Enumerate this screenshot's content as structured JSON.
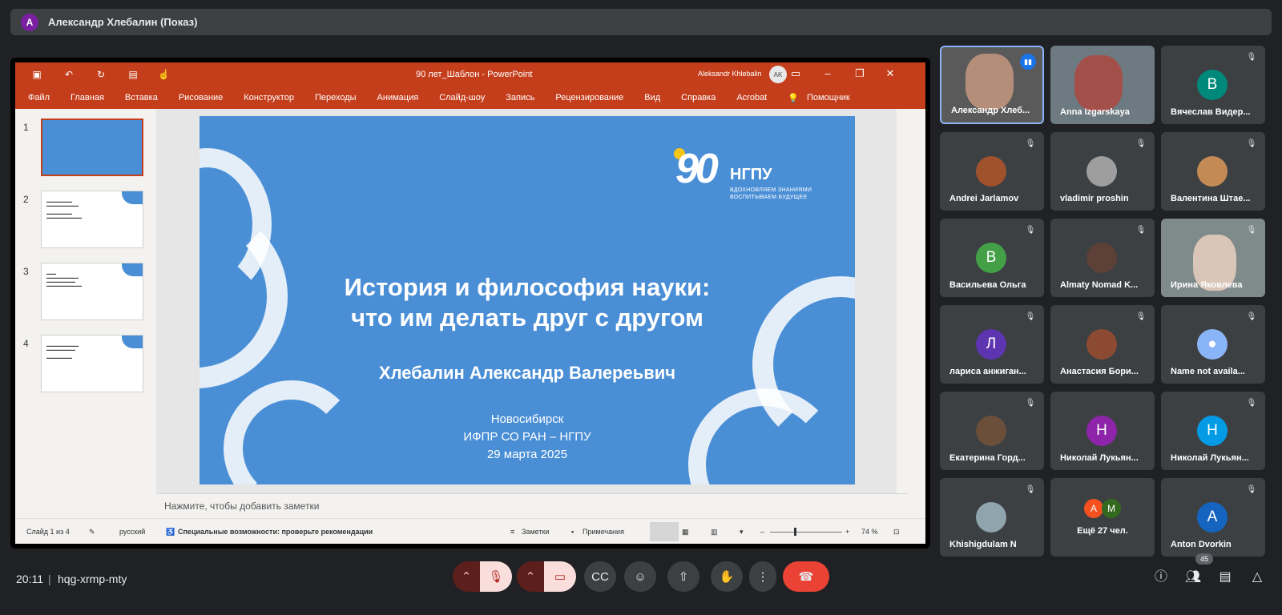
{
  "presenter": {
    "avatar_letter": "А",
    "label": "Александр Хлебалин (Показ)"
  },
  "ppt": {
    "doc_title": "90 лет_Шаблон  -  PowerPoint",
    "account": "Aleksandr Khlebalin",
    "account_initials": "AK",
    "menu": [
      "Файл",
      "Главная",
      "Вставка",
      "Рисование",
      "Конструктор",
      "Переходы",
      "Анимация",
      "Слайд-шоу",
      "Запись",
      "Рецензирование",
      "Вид",
      "Справка",
      "Acrobat"
    ],
    "helper": "Помощник",
    "thumb_numbers": [
      "1",
      "2",
      "3",
      "4"
    ],
    "slide": {
      "title_line1": "История и философия науки:",
      "title_line2": "что им делать друг с другом",
      "author": "Хлебалин Александр Валереьвич",
      "city": "Новосибирск",
      "org": "ИФПР СО РАН – НГПУ",
      "date": "29 марта 2025",
      "logo_number": "90",
      "logo_name": "НГПУ",
      "logo_tag1": "ВДОХНОВЛЯЕМ ЗНАНИЯМИ",
      "logo_tag2": "ВОСПИТЫВАЕМ БУДУЩЕЕ"
    },
    "notes_placeholder": "Нажмите, чтобы добавить заметки",
    "status": {
      "slide": "Слайд 1 из 4",
      "lang": "русский",
      "accessibility": "Специальные возможности: проверьте рекомендации",
      "notes": "Заметки",
      "comments": "Примечания",
      "zoom": "74 %"
    }
  },
  "participants": [
    {
      "name": "Александр Хлеб...",
      "type": "video",
      "speaking": true
    },
    {
      "name": "Anna Izgarskaya",
      "type": "video"
    },
    {
      "name": "Вячеслав Видер...",
      "letter": "В",
      "color": "#00897b"
    },
    {
      "name": "Andrei Jarlamov",
      "type": "photo"
    },
    {
      "name": "vladimir proshin",
      "type": "photo"
    },
    {
      "name": "Валентина Штае...",
      "type": "photo"
    },
    {
      "name": "Васильева Ольга",
      "letter": "В",
      "color": "#43a047"
    },
    {
      "name": "Almaty Nomad K...",
      "type": "photo"
    },
    {
      "name": "Ирина Яковлева",
      "type": "video"
    },
    {
      "name": "лариса анжиган...",
      "letter": "Л",
      "color": "#5e35b1"
    },
    {
      "name": "Анастасия Бори...",
      "type": "photo"
    },
    {
      "name": "Name not availa...",
      "type": "generic"
    },
    {
      "name": "Екатерина Горд...",
      "type": "photo"
    },
    {
      "name": "Николай Лукьян...",
      "letter": "Н",
      "color": "#8e24aa"
    },
    {
      "name": "Николай Лукьян...",
      "letter": "Н",
      "color": "#039be5"
    },
    {
      "name": "Khishigdulam N",
      "type": "photo"
    },
    {
      "name": "Ещё 27 чел.",
      "type": "more",
      "letters": [
        "А",
        "M"
      ]
    },
    {
      "name": "Anton Dvorkin",
      "letter": "A",
      "color": "#1565c0"
    }
  ],
  "meeting": {
    "time": "20:11",
    "code": "hqg-xrmp-mty",
    "participant_count": "45"
  }
}
